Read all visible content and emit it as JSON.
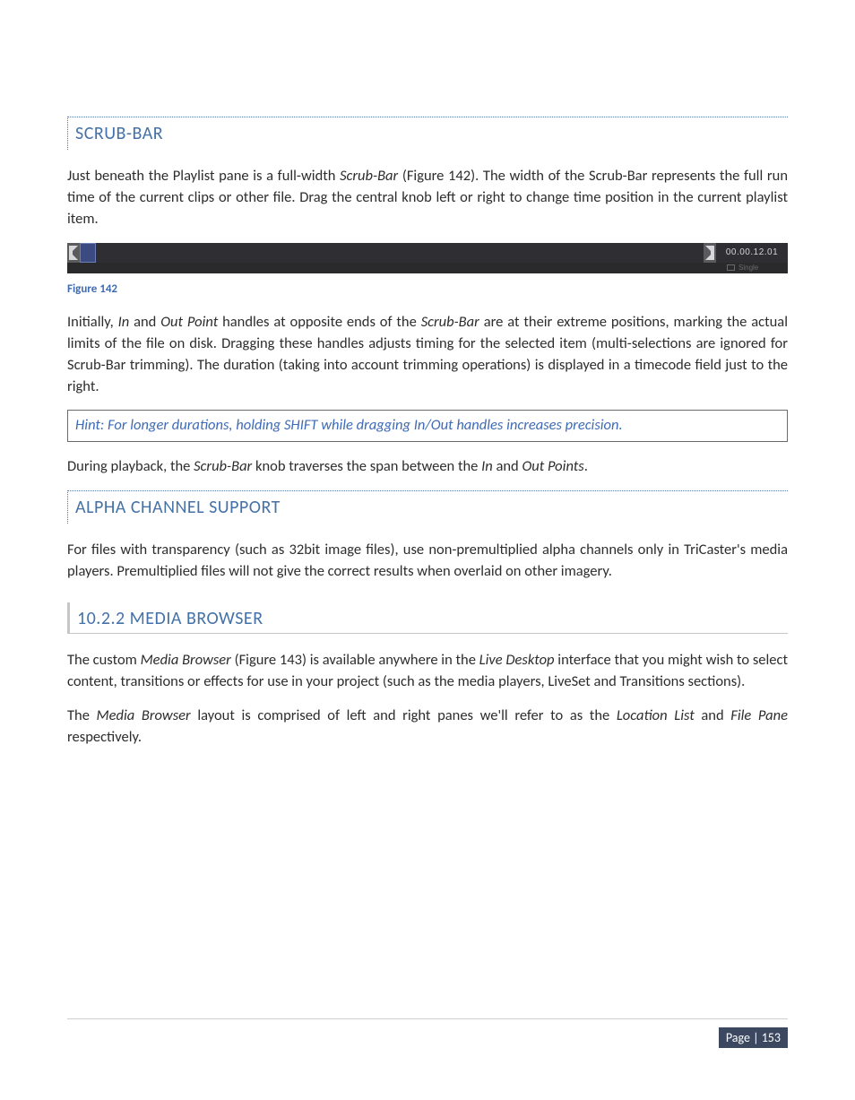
{
  "section1": {
    "heading": "SCRUB-BAR",
    "p1_pre": "Just beneath the Playlist pane is a full-width ",
    "p1_em1": "Scrub-Bar",
    "p1_post": " (Figure 142).   The width of the Scrub-Bar represents the full run time of the current clips or other file.    Drag the central knob left or right to change time position in the current playlist item.",
    "timecode": "00.00.12.01",
    "single_label": "Single",
    "caption": "Figure 142",
    "p2_pre": "Initially, ",
    "p2_em1": "In",
    "p2_mid1": " and ",
    "p2_em2": "Out Point",
    "p2_mid2": " handles at opposite ends of the ",
    "p2_em3": "Scrub-Bar",
    "p2_post": " are at their extreme positions, marking the actual limits of the file on disk.  Dragging these handles adjusts timing for the selected item (multi-selections are ignored for Scrub-Bar trimming).   The duration (taking into account trimming operations) is displayed in a timecode field just to the right.",
    "hint": "Hint: For longer durations, holding SHIFT while dragging In/Out handles increases precision.",
    "p3_pre": "During playback, the ",
    "p3_em1": "Scrub-Bar",
    "p3_mid1": " knob traverses the span between the ",
    "p3_em2": "In",
    "p3_mid2": " and ",
    "p3_em3": "Out Points",
    "p3_post": "."
  },
  "section2": {
    "heading": "ALPHA CHANNEL SUPPORT",
    "p1": "For files with transparency (such as 32bit image files), use non-premultiplied alpha channels only in TriCaster's media players.   Premultiplied files will not give the correct results when overlaid on other imagery."
  },
  "section3": {
    "heading": "10.2.2 MEDIA BROWSER",
    "p1_pre": "The custom ",
    "p1_em1": "Media Browser",
    "p1_mid1": " (Figure 143) is available anywhere in the ",
    "p1_em2": "Live Desktop",
    "p1_post": " interface that you might wish to select content, transitions or effects for use in your project (such as the media players, LiveSet and Transitions sections).",
    "p2_pre": "The ",
    "p2_em1": "Media Browser",
    "p2_mid1": " layout is comprised of left and right panes we'll refer to as the ",
    "p2_em2": "Location List",
    "p2_mid2": " and ",
    "p2_em3": "File Pane",
    "p2_post": " respectively."
  },
  "footer": {
    "page": "Page | 153"
  }
}
